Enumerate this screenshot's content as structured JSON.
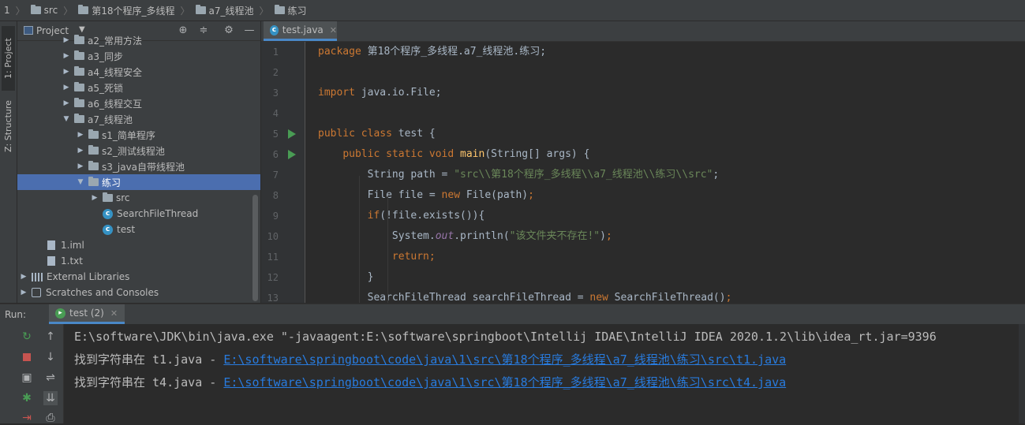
{
  "breadcrumb": [
    "1",
    "src",
    "第18个程序_多线程",
    "a7_线程池",
    "练习"
  ],
  "left_stripe": {
    "project_tab": "1: Project",
    "structure_tab": "Z: Structure"
  },
  "project_panel": {
    "title": "Project",
    "tree": [
      {
        "label": "a2_常用方法",
        "depth": 1,
        "type": "folder",
        "expanded": false
      },
      {
        "label": "a3_同步",
        "depth": 1,
        "type": "folder",
        "expanded": false
      },
      {
        "label": "a4_线程安全",
        "depth": 1,
        "type": "folder",
        "expanded": false
      },
      {
        "label": "a5_死锁",
        "depth": 1,
        "type": "folder",
        "expanded": false
      },
      {
        "label": "a6_线程交互",
        "depth": 1,
        "type": "folder",
        "expanded": false
      },
      {
        "label": "a7_线程池",
        "depth": 1,
        "type": "folder",
        "expanded": true
      },
      {
        "label": "s1_简单程序",
        "depth": 2,
        "type": "folder",
        "expanded": false
      },
      {
        "label": "s2_测试线程池",
        "depth": 2,
        "type": "folder",
        "expanded": false
      },
      {
        "label": "s3_java自带线程池",
        "depth": 2,
        "type": "folder",
        "expanded": false
      },
      {
        "label": "练习",
        "depth": 2,
        "type": "folder",
        "expanded": true,
        "selected": true
      },
      {
        "label": "src",
        "depth": 3,
        "type": "folder",
        "expanded": false
      },
      {
        "label": "SearchFileThread",
        "depth": 3,
        "type": "class"
      },
      {
        "label": "test",
        "depth": 3,
        "type": "class-run"
      },
      {
        "label": "1.iml",
        "depth": 0,
        "type": "file"
      },
      {
        "label": "1.txt",
        "depth": 0,
        "type": "file"
      },
      {
        "label": "External Libraries",
        "depth": -1,
        "type": "lib",
        "expanded": false
      },
      {
        "label": "Scratches and Consoles",
        "depth": -1,
        "type": "scratch",
        "expanded": false
      }
    ]
  },
  "editor": {
    "tab_label": "test.java",
    "lines": [
      {
        "n": "1",
        "html": "<span class='kw'>package</span> 第18个程序_多线程.a7_线程池.练习;"
      },
      {
        "n": "2",
        "html": ""
      },
      {
        "n": "3",
        "html": "<span class='kw'>import</span> java.io.File;"
      },
      {
        "n": "4",
        "html": ""
      },
      {
        "n": "5",
        "html": "<span class='kw'>public class</span> test {"
      },
      {
        "n": "6",
        "html": "    <span class='kw'>public static void</span> <span class='fn'>main</span>(String[] args) {"
      },
      {
        "n": "7",
        "html": "        String path = <span class='str'>\"src\\\\第18个程序_多线程\\\\a7_线程池\\\\练习\\\\src\"</span>;"
      },
      {
        "n": "8",
        "html": "        File file = <span class='kw'>new</span> File(path)<span class='kw'>;</span>"
      },
      {
        "n": "9",
        "html": "        <span class='kw'>if</span>(!file.exists()){"
      },
      {
        "n": "10",
        "html": "            System.<span class='it'>out</span>.println(<span class='str'>\"该文件夹不存在!\"</span>)<span class='kw'>;</span>"
      },
      {
        "n": "11",
        "html": "            <span class='kw'>return;</span>"
      },
      {
        "n": "12",
        "html": "        }"
      },
      {
        "n": "13",
        "html": "        SearchFileThread searchFileThread = <span class='kw'>new</span> SearchFileThread()<span class='kw'>;</span>"
      }
    ]
  },
  "run_panel": {
    "label": "Run:",
    "tab_label": "test (2)",
    "console": [
      {
        "text": "E:\\software\\JDK\\bin\\java.exe \"-javaagent:E:\\software\\springboot\\Intellij IDAE\\IntelliJ IDEA 2020.1.2\\lib\\idea_rt.jar=9396",
        "link": ""
      },
      {
        "text": "找到字符串在 t1.java - ",
        "link": "E:\\software\\springboot\\code\\java\\1\\src\\第18个程序_多线程\\a7_线程池\\练习\\src\\t1.java"
      },
      {
        "text": "找到字符串在 t4.java - ",
        "link": "E:\\software\\springboot\\code\\java\\1\\src\\第18个程序_多线程\\a7_线程池\\练习\\src\\t4.java"
      }
    ]
  },
  "colors": {
    "background": "#2b2b2b",
    "panel": "#3c3f41",
    "selection": "#4b6eaf",
    "keyword": "#cc7832",
    "string": "#6a8759",
    "link": "#287bde",
    "run_green": "#499c54"
  }
}
